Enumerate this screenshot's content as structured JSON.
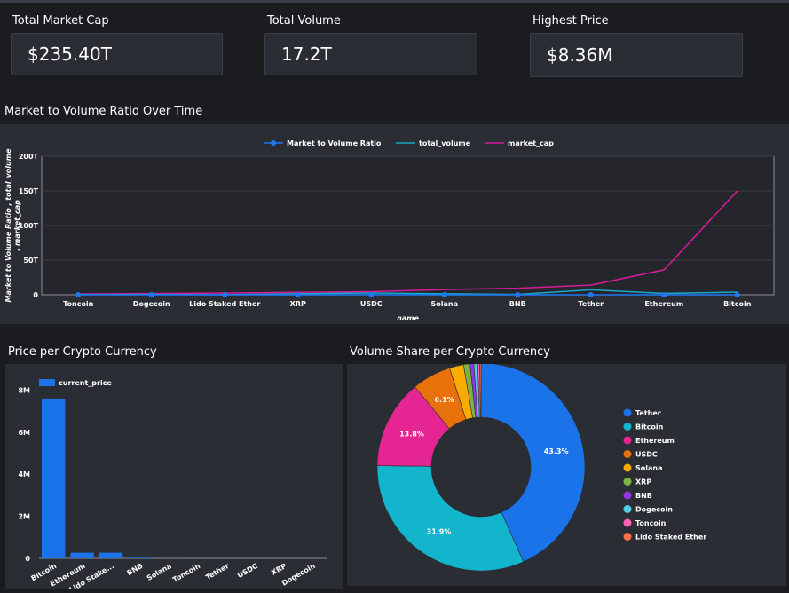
{
  "kpis": [
    {
      "title": "Total Market Cap",
      "value": "$235.40T"
    },
    {
      "title": "Total Volume",
      "value": "17.2T"
    },
    {
      "title": "Highest Price",
      "value": "$8.36M"
    }
  ],
  "colors": {
    "background": "#1b1c20",
    "panel": "#2b2d34",
    "ratio": "#1f77f4",
    "volume": "#17a9c8",
    "market_cap": "#d81b9a",
    "bar": "#1a73e8"
  },
  "chart_data": [
    {
      "type": "line",
      "title": "Market to Volume Ratio Over Time",
      "xlabel": "name",
      "ylabel": "Market to Volume Ratio , total_volume , market_cap",
      "ylabel_lines": [
        "Market to Volume Ratio , total_volume",
        ", market_cap"
      ],
      "categories": [
        "Toncoin",
        "Dogecoin",
        "Lido Staked Ether",
        "XRP",
        "USDC",
        "Solana",
        "BNB",
        "Tether",
        "Ethereum",
        "Bitcoin"
      ],
      "yticks": [
        "0",
        "50T",
        "100T",
        "150T",
        "200T"
      ],
      "ytick_values": [
        0,
        50,
        100,
        150,
        200
      ],
      "ylim": [
        0,
        200
      ],
      "y_unit": "T",
      "legend_position": "top",
      "series": [
        {
          "name": "Market to Volume Ratio",
          "color": "#1f77f4",
          "marker": true,
          "values": [
            0,
            0,
            0,
            0,
            0,
            0,
            0,
            0,
            0,
            0
          ]
        },
        {
          "name": "total_volume",
          "color": "#17a9c8",
          "marker": false,
          "values": [
            0.3,
            0.5,
            0.1,
            1.5,
            2.5,
            1.5,
            0.5,
            7.2,
            2.0,
            3.8
          ]
        },
        {
          "name": "market_cap",
          "color": "#d81b9a",
          "marker": false,
          "values": [
            1.2,
            1.8,
            2.5,
            3.5,
            4.5,
            7.5,
            9.5,
            14.0,
            36.0,
            150.0
          ]
        }
      ]
    },
    {
      "type": "bar",
      "title": "Price per Crypto Currency",
      "categories": [
        "Bitcoin",
        "Ethereum",
        "Lido Stake...",
        "BNB",
        "Solana",
        "Toncoin",
        "Tether",
        "USDC",
        "XRP",
        "Dogecoin"
      ],
      "series": [
        {
          "name": "current_price",
          "values": [
            7.6,
            0.27,
            0.27,
            0.03,
            0.004,
            0.001,
            0.0,
            0.0,
            0.0,
            0.0
          ]
        }
      ],
      "yticks": [
        "0",
        "2M",
        "4M",
        "6M",
        "8M"
      ],
      "ytick_values": [
        0,
        2,
        4,
        6,
        8
      ],
      "ylim": [
        0,
        8.4
      ],
      "y_unit": "M",
      "legend_position": "top-left"
    },
    {
      "type": "pie",
      "title": "Volume Share per Crypto Currency",
      "donut": true,
      "legend_position": "right",
      "labels": [
        "Tether",
        "Bitcoin",
        "Ethereum",
        "USDC",
        "Solana",
        "XRP",
        "BNB",
        "Dogecoin",
        "Toncoin",
        "Lido Staked Ether"
      ],
      "values": [
        43.3,
        31.9,
        13.8,
        6.1,
        2.2,
        1.0,
        0.6,
        0.6,
        0.3,
        0.2
      ],
      "value_labels": [
        "43.3%",
        "31.9%",
        "13.8%",
        "6.1%",
        "",
        "",
        "",
        "",
        "",
        ""
      ],
      "colors": [
        "#1a73e8",
        "#12b5cb",
        "#e52592",
        "#e8710a",
        "#f9ab00",
        "#7cb342",
        "#9334e6",
        "#4ecde6",
        "#ff63b8",
        "#ff7043"
      ]
    }
  ]
}
